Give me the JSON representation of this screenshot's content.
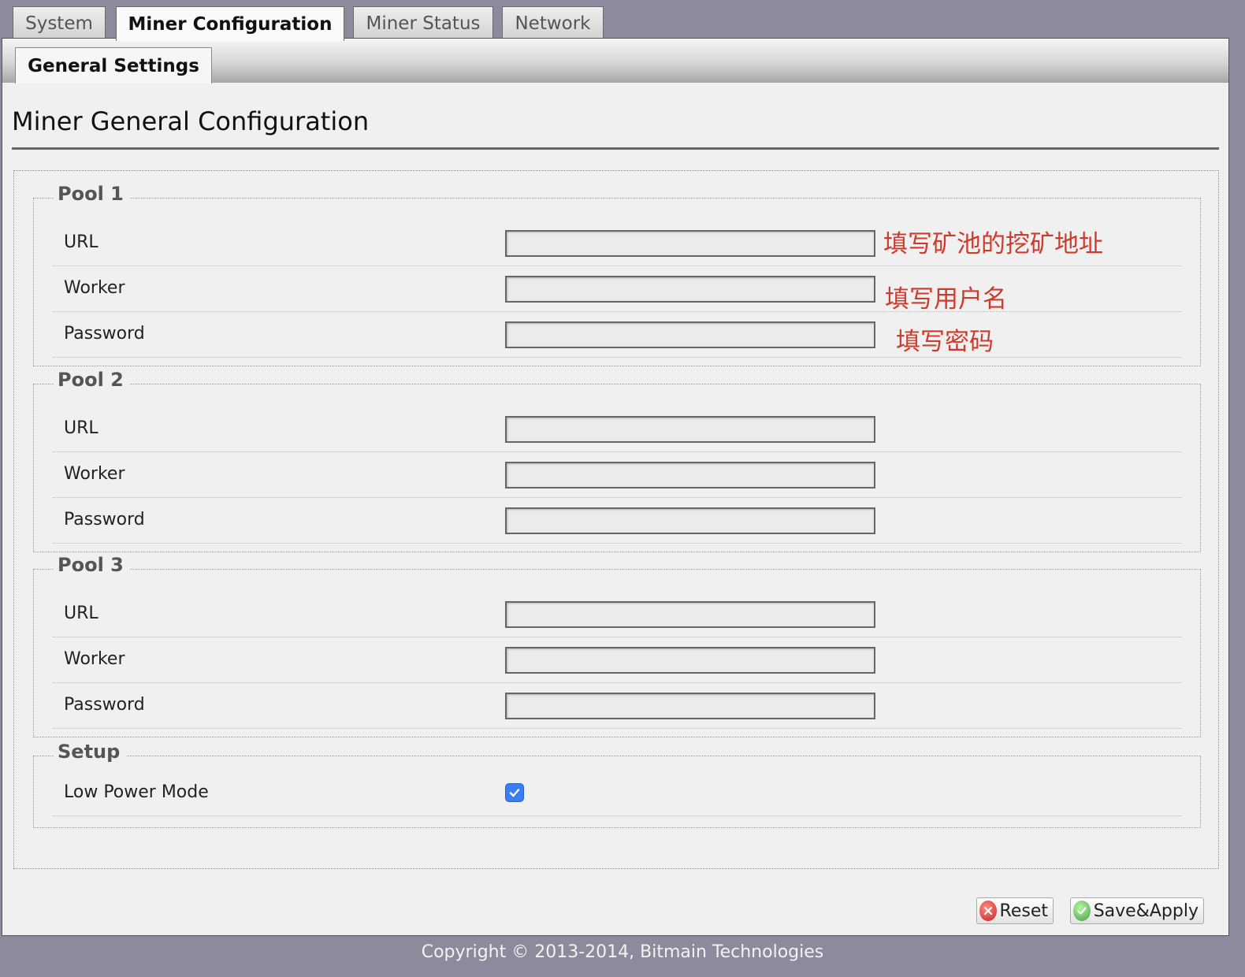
{
  "tabs": {
    "system": "System",
    "miner_configuration": "Miner Configuration",
    "miner_status": "Miner Status",
    "network": "Network",
    "active": "Miner Configuration"
  },
  "subtabs": {
    "general_settings": "General Settings"
  },
  "page_title": "Miner General Configuration",
  "pools": [
    {
      "legend": "Pool 1",
      "url_label": "URL",
      "url_value": "",
      "worker_label": "Worker",
      "worker_value": "",
      "password_label": "Password",
      "password_value": ""
    },
    {
      "legend": "Pool 2",
      "url_label": "URL",
      "url_value": "",
      "worker_label": "Worker",
      "worker_value": "",
      "password_label": "Password",
      "password_value": ""
    },
    {
      "legend": "Pool 3",
      "url_label": "URL",
      "url_value": "",
      "worker_label": "Worker",
      "worker_value": "",
      "password_label": "Password",
      "password_value": ""
    }
  ],
  "annotations": {
    "url": "填写矿池的挖矿地址",
    "worker": "填写用户名",
    "password": "填写密码",
    "color": "#cc3b2b",
    "arrow_icon": "arrow-pointer-icon"
  },
  "setup": {
    "legend": "Setup",
    "low_power_label": "Low Power Mode",
    "low_power_checked": true
  },
  "buttons": {
    "reset": "Reset",
    "save_apply": "Save&Apply"
  },
  "icons": {
    "reset": "close-circle-icon",
    "save_apply": "check-circle-icon",
    "checkbox": "checkmark-icon"
  },
  "footer": "Copyright © 2013-2014, Bitmain Technologies",
  "colors": {
    "background": "#8e8a9e",
    "panel": "#f0f0f0",
    "checkbox_accent": "#3b7df2"
  }
}
